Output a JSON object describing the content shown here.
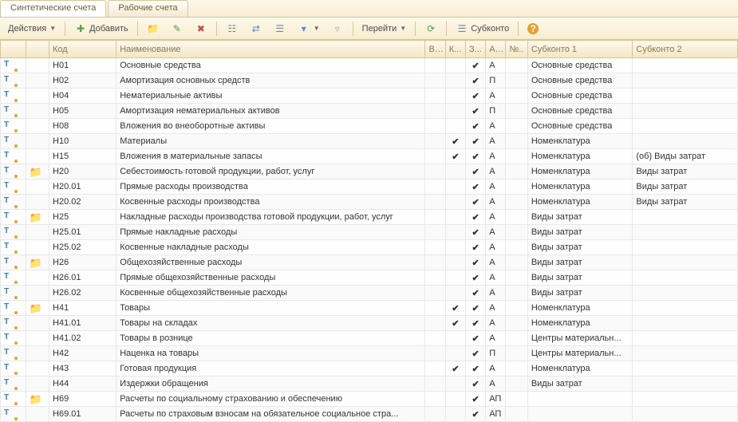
{
  "tabs": {
    "synthetic": "Синтетические счета",
    "working": "Рабочие счета"
  },
  "toolbar": {
    "actions": "Действия",
    "add": "Добавить",
    "goto": "Перейти",
    "subkonto": "Субконто"
  },
  "headers": {
    "code": "Код",
    "name": "Наименование",
    "v": "В...",
    "k": "К...",
    "z": "З...",
    "a": "А...",
    "n": "№..",
    "s1": "Субконто 1",
    "s2": "Субконто 2"
  },
  "rows": [
    {
      "folder": false,
      "code": "Н01",
      "name": "Основные средства",
      "v": false,
      "k": false,
      "z": true,
      "a": "А",
      "s1": "Основные средства",
      "s2": ""
    },
    {
      "folder": false,
      "code": "Н02",
      "name": "Амортизация основных средств",
      "v": false,
      "k": false,
      "z": true,
      "a": "П",
      "s1": "Основные средства",
      "s2": ""
    },
    {
      "folder": false,
      "code": "Н04",
      "name": "Нематериальные активы",
      "v": false,
      "k": false,
      "z": true,
      "a": "А",
      "s1": "Основные средства",
      "s2": ""
    },
    {
      "folder": false,
      "code": "Н05",
      "name": "Амортизация нематериальных активов",
      "v": false,
      "k": false,
      "z": true,
      "a": "П",
      "s1": "Основные средства",
      "s2": ""
    },
    {
      "folder": false,
      "code": "Н08",
      "name": "Вложения во внеоборотные активы",
      "v": false,
      "k": false,
      "z": true,
      "a": "А",
      "s1": "Основные средства",
      "s2": ""
    },
    {
      "folder": false,
      "code": "Н10",
      "name": "Материалы",
      "v": false,
      "k": true,
      "z": true,
      "a": "А",
      "s1": "Номенклатура",
      "s2": ""
    },
    {
      "folder": false,
      "code": "Н15",
      "name": "Вложения в материальные запасы",
      "v": false,
      "k": true,
      "z": true,
      "a": "А",
      "s1": "Номенклатура",
      "s2": "(об) Виды затрат"
    },
    {
      "folder": true,
      "code": "Н20",
      "name": "Себестоимость готовой продукции, работ, услуг",
      "v": false,
      "k": false,
      "z": true,
      "a": "А",
      "s1": "Номенклатура",
      "s2": "Виды затрат"
    },
    {
      "folder": false,
      "code": "Н20.01",
      "name": "Прямые расходы производства",
      "v": false,
      "k": false,
      "z": true,
      "a": "А",
      "s1": "Номенклатура",
      "s2": "Виды затрат"
    },
    {
      "folder": false,
      "code": "Н20.02",
      "name": "Косвенные расходы производства",
      "v": false,
      "k": false,
      "z": true,
      "a": "А",
      "s1": "Номенклатура",
      "s2": "Виды затрат"
    },
    {
      "folder": true,
      "code": "Н25",
      "name": "Накладные расходы производства готовой продукции, работ, услуг",
      "v": false,
      "k": false,
      "z": true,
      "a": "А",
      "s1": "Виды затрат",
      "s2": ""
    },
    {
      "folder": false,
      "code": "Н25.01",
      "name": "Прямые накладные расходы",
      "v": false,
      "k": false,
      "z": true,
      "a": "А",
      "s1": "Виды затрат",
      "s2": ""
    },
    {
      "folder": false,
      "code": "Н25.02",
      "name": "Косвенные накладные расходы",
      "v": false,
      "k": false,
      "z": true,
      "a": "А",
      "s1": "Виды затрат",
      "s2": ""
    },
    {
      "folder": true,
      "code": "Н26",
      "name": "Общехозяйственные расходы",
      "v": false,
      "k": false,
      "z": true,
      "a": "А",
      "s1": "Виды затрат",
      "s2": ""
    },
    {
      "folder": false,
      "code": "Н26.01",
      "name": "Прямые общехозяйственные расходы",
      "v": false,
      "k": false,
      "z": true,
      "a": "А",
      "s1": "Виды затрат",
      "s2": ""
    },
    {
      "folder": false,
      "code": "Н26.02",
      "name": "Косвенные общехозяйственные расходы",
      "v": false,
      "k": false,
      "z": true,
      "a": "А",
      "s1": "Виды затрат",
      "s2": ""
    },
    {
      "folder": true,
      "code": "Н41",
      "name": "Товары",
      "v": false,
      "k": true,
      "z": true,
      "a": "А",
      "s1": "Номенклатура",
      "s2": ""
    },
    {
      "folder": false,
      "code": "Н41.01",
      "name": "Товары на складах",
      "v": false,
      "k": true,
      "z": true,
      "a": "А",
      "s1": "Номенклатура",
      "s2": ""
    },
    {
      "folder": false,
      "code": "Н41.02",
      "name": "Товары в рознице",
      "v": false,
      "k": false,
      "z": true,
      "a": "А",
      "s1": "Центры материальн...",
      "s2": ""
    },
    {
      "folder": false,
      "code": "Н42",
      "name": "Наценка на товары",
      "v": false,
      "k": false,
      "z": true,
      "a": "П",
      "s1": "Центры материальн...",
      "s2": ""
    },
    {
      "folder": false,
      "code": "Н43",
      "name": "Готовая продукция",
      "v": false,
      "k": true,
      "z": true,
      "a": "А",
      "s1": "Номенклатура",
      "s2": ""
    },
    {
      "folder": false,
      "code": "Н44",
      "name": "Издержки обращения",
      "v": false,
      "k": false,
      "z": true,
      "a": "А",
      "s1": "Виды затрат",
      "s2": ""
    },
    {
      "folder": true,
      "code": "Н69",
      "name": "Расчеты по социальному страхованию и обеспечению",
      "v": false,
      "k": false,
      "z": true,
      "a": "АП",
      "s1": "",
      "s2": ""
    },
    {
      "folder": false,
      "code": "Н69.01",
      "name": "Расчеты по страховым взносам на обязательное социальное стра...",
      "v": false,
      "k": false,
      "z": true,
      "a": "АП",
      "s1": "",
      "s2": ""
    }
  ]
}
